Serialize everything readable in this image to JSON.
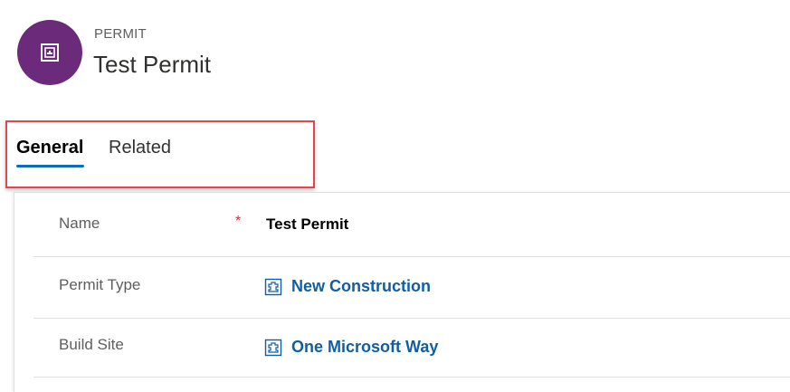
{
  "header": {
    "entity_type": "PERMIT",
    "record_title": "Test Permit",
    "icon": "permit-entity-icon",
    "icon_color": "#6b2a7a"
  },
  "tabs": [
    {
      "label": "General",
      "selected": true
    },
    {
      "label": "Related",
      "selected": false
    }
  ],
  "colors": {
    "tab_accent": "#0f6cbd",
    "highlight_border": "#e0484d",
    "lookup_link": "#115ea3",
    "required": "#d13438"
  },
  "form": {
    "name": {
      "label": "Name",
      "required_mark": "*",
      "value": "Test Permit"
    },
    "permit_type": {
      "label": "Permit Type",
      "value": "New Construction",
      "icon": "lookup-record-icon"
    },
    "build_site": {
      "label": "Build Site",
      "value": "One Microsoft Way",
      "icon": "lookup-record-icon"
    }
  }
}
